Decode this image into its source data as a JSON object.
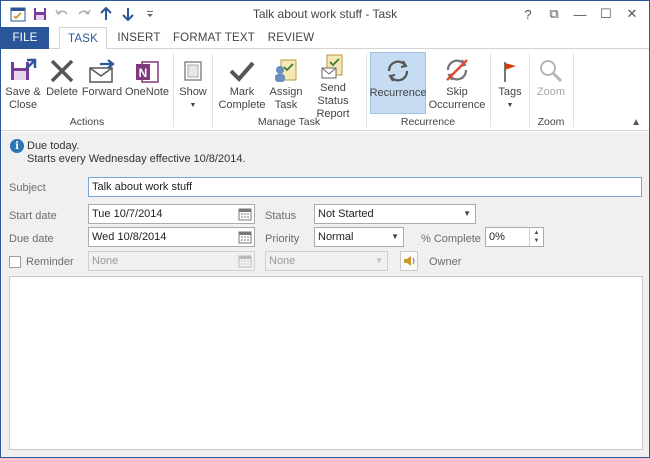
{
  "window": {
    "title": "Talk about work stuff - Task",
    "controls": {
      "help": "?",
      "restore_ribbon": "⧉",
      "minimize": "—",
      "maximize": "☐",
      "close": "✕"
    }
  },
  "quick_access": {
    "items": [
      "save-icon",
      "undo-icon",
      "redo-icon",
      "up-arrow-icon",
      "down-arrow-icon",
      "customize-icon"
    ]
  },
  "tabs": [
    {
      "label": "FILE"
    },
    {
      "label": "TASK"
    },
    {
      "label": "INSERT"
    },
    {
      "label": "FORMAT TEXT"
    },
    {
      "label": "REVIEW"
    }
  ],
  "ribbon": {
    "groups": {
      "actions": "Actions",
      "manage_task": "Manage Task",
      "recurrence": "Recurrence",
      "zoom": "Zoom"
    },
    "buttons": {
      "save_close": [
        "Save &",
        "Close"
      ],
      "delete": "Delete",
      "forward": "Forward",
      "onenote": "OneNote",
      "show": "Show",
      "mark_complete": [
        "Mark",
        "Complete"
      ],
      "assign_task": [
        "Assign",
        "Task"
      ],
      "send_status": [
        "Send Status",
        "Report"
      ],
      "recurrence": "Recurrence",
      "skip_occurrence": [
        "Skip",
        "Occurrence"
      ],
      "tags": "Tags",
      "zoom": "Zoom"
    }
  },
  "info": {
    "line1": "Due today.",
    "line2": "Starts every Wednesday effective 10/8/2014."
  },
  "form": {
    "subject_label": "Subject",
    "subject_value": "Talk about work stuff",
    "start_date_label": "Start date",
    "start_date_value": "Tue 10/7/2014",
    "due_date_label": "Due date",
    "due_date_value": "Wed 10/8/2014",
    "status_label": "Status",
    "status_value": "Not Started",
    "priority_label": "Priority",
    "priority_value": "Normal",
    "percent_label": "% Complete",
    "percent_value": "0%",
    "reminder_label": "Reminder",
    "reminder_date": "None",
    "reminder_time": "None",
    "owner_label": "Owner"
  },
  "colors": {
    "accent": "#2b579a",
    "active_button": "#c5dcf2",
    "info_icon": "#2e75b6",
    "onenote": "#80397b"
  }
}
